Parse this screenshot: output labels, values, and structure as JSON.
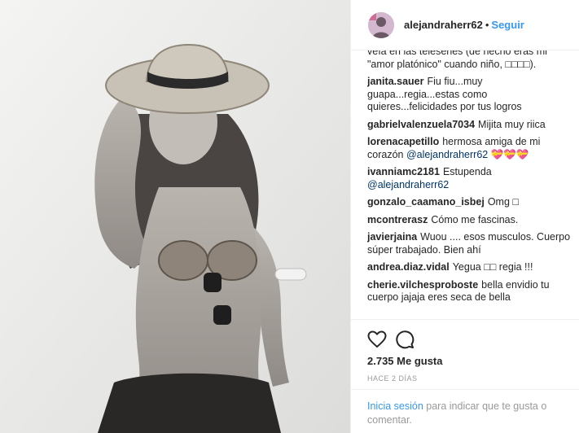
{
  "post": {
    "username": "alejandraherr62",
    "separator": "•",
    "follow_label": "Seguir"
  },
  "comments": {
    "partial_text": "veía en las teleseries (de hecho eras mi \"amor platónico\" cuando niño, □□□□).",
    "items": [
      {
        "user": "janita.sauer",
        "text": "Fiu fiu...muy guapa...regia...estas como quieres...felicidades por tus logros"
      },
      {
        "user": "gabrielvalenzuela7034",
        "text": "Mijita muy riica"
      },
      {
        "user": "lorenacapetillo",
        "text": "hermosa amiga de mi corazón",
        "mention": "@alejandraherr62",
        "suffix": "💝💝💝"
      },
      {
        "user": "ivanniamc2181",
        "text": "Estupenda",
        "mention": "@alejandraherr62"
      },
      {
        "user": "gonzalo_caamano_isbej",
        "text": "Omg □"
      },
      {
        "user": "mcontrerasz",
        "text": "Cómo me fascinas."
      },
      {
        "user": "javierjaina",
        "text": "Wuou .... esos musculos. Cuerpo súper trabajado. Bien ahí"
      },
      {
        "user": "andrea.diaz.vidal",
        "text": "Yegua □□ regia !!!"
      },
      {
        "user": "cherie.vilchesproboste",
        "text": "bella envidio tu cuerpo jajaja eres seca de bella"
      }
    ]
  },
  "actions": {
    "like_icon": "heart-outline-icon",
    "comment_icon": "comment-bubble-icon"
  },
  "likes_text": "2.735 Me gusta",
  "time_ago": "HACE 2 DÍAS",
  "login_prompt": {
    "link_label": "Inicia sesión",
    "rest": "para indicar que te gusta o comentar."
  },
  "colors": {
    "link_blue": "#3897f0",
    "mention_blue": "#003569",
    "muted_gray": "#999999",
    "divider": "#efefef"
  }
}
